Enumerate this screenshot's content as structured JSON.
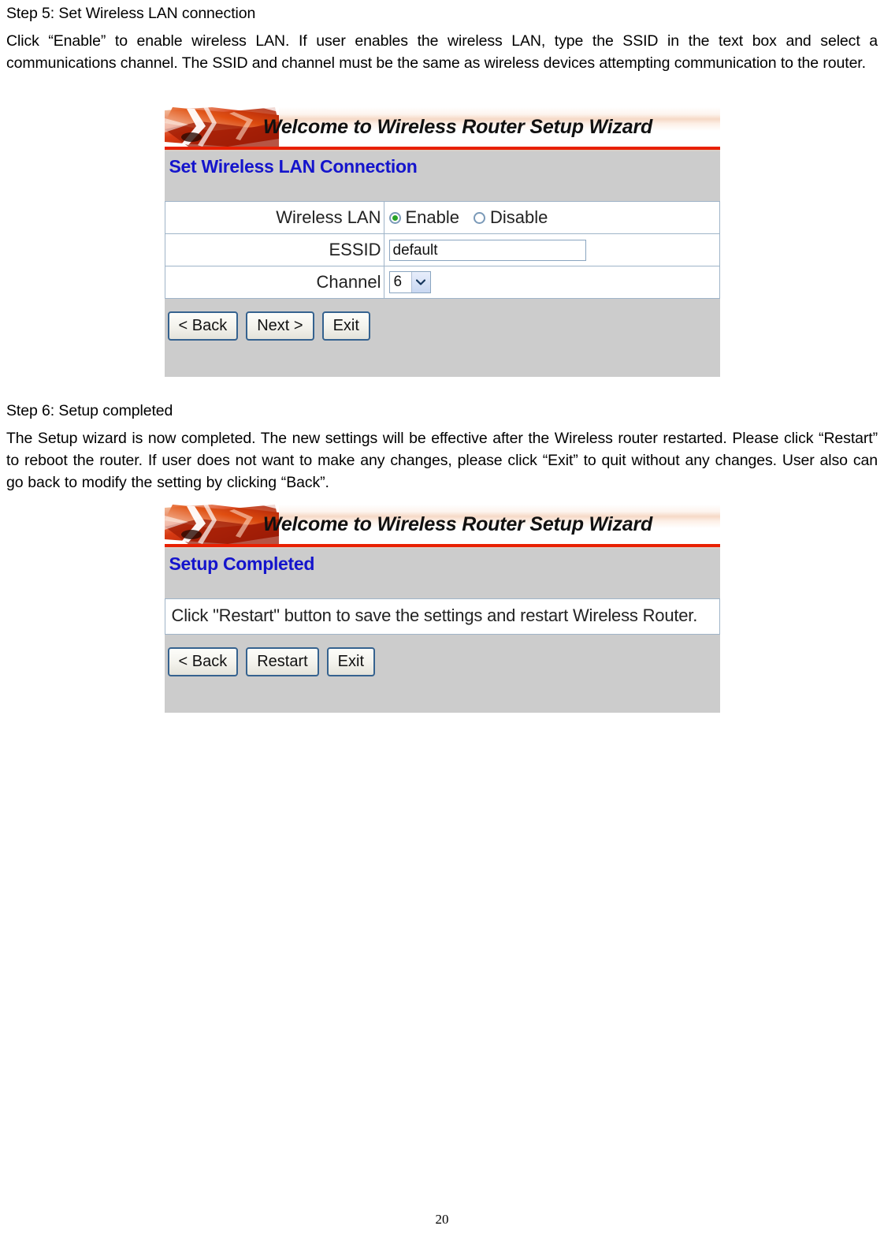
{
  "document": {
    "page_number": "20",
    "step5": {
      "heading": "Step 5: Set Wireless LAN connection",
      "paragraph": "Click “Enable” to enable wireless LAN. If user enables the wireless LAN, type the SSID in the text box and select a communications channel. The SSID and channel must be the same as wireless devices attempting communication to the router."
    },
    "step6": {
      "heading": "Step 6: Setup completed",
      "paragraph": "The Setup wizard is now completed. The new settings will be effective after the Wireless router restarted. Please click “Restart” to reboot the router. If user does not want to make any changes, please click “Exit” to quit without any changes. User also can go back to modify the setting by clicking “Back”."
    }
  },
  "colors": {
    "banner_rule": "#e82000",
    "section_title": "#1414CC",
    "panel_bg": "#CCCCCC",
    "field_border": "#9FB4C8",
    "radio_selected": "#26A226",
    "button_border": "#35628F"
  },
  "wizard_wireless": {
    "banner_title": "Welcome to Wireless Router Setup Wizard",
    "banner_icon": "burst-graphic-icon",
    "section_title": "Set Wireless LAN Connection",
    "rows": [
      {
        "label": "Wireless LAN",
        "type": "radio",
        "options": [
          {
            "label": "Enable",
            "checked": true
          },
          {
            "label": "Disable",
            "checked": false
          }
        ]
      },
      {
        "label": "ESSID",
        "type": "text",
        "value": "default",
        "placeholder": ""
      },
      {
        "label": "Channel",
        "type": "select",
        "value": "6"
      }
    ],
    "buttons": [
      {
        "label": "< Back",
        "name": "back-button"
      },
      {
        "label": "Next >",
        "name": "next-button"
      },
      {
        "label": "Exit",
        "name": "exit-button"
      }
    ]
  },
  "wizard_completed": {
    "banner_title": "Welcome to Wireless Router Setup Wizard",
    "banner_icon": "burst-graphic-icon",
    "section_title": "Setup Completed",
    "message": "Click \"Restart\" button to save the settings and restart Wireless Router.",
    "buttons": [
      {
        "label": "< Back",
        "name": "back-button"
      },
      {
        "label": "Restart",
        "name": "restart-button"
      },
      {
        "label": "Exit",
        "name": "exit-button"
      }
    ]
  }
}
